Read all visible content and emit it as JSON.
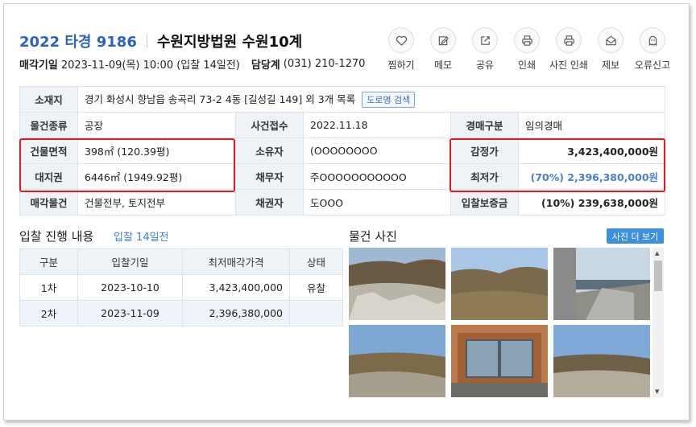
{
  "header": {
    "case_number": "2022 타경 9186",
    "court": "수원지방법원 수원10계",
    "sale_date_label": "매각기일",
    "sale_date_value": "2023-11-09(목) 10:00 (입찰 14일전)",
    "dept_label": "담당계",
    "dept_phone": "(031) 210-1270"
  },
  "actions": [
    {
      "label": "찜하기",
      "icon": "heart-icon"
    },
    {
      "label": "메모",
      "icon": "memo-icon"
    },
    {
      "label": "공유",
      "icon": "share-icon"
    },
    {
      "label": "인쇄",
      "icon": "print-icon"
    },
    {
      "label": "사진 인쇄",
      "icon": "photo-print-icon"
    },
    {
      "label": "제보",
      "icon": "report-icon"
    },
    {
      "label": "오류신고",
      "icon": "error-report-icon"
    }
  ],
  "info": {
    "location_label": "소재지",
    "location_value": "경기 화성시 향남읍 송곡리 73-2 4동 [길성길 149] 외 3개 목록",
    "road_search_button": "도로명 검색",
    "type_label": "물건종류",
    "type_value": "공장",
    "case_received_label": "사건접수",
    "case_received_value": "2022.11.18",
    "auction_type_label": "경매구분",
    "auction_type_value": "임의경매",
    "building_area_label": "건물면적",
    "building_area_value": "398㎡ (120.39평)",
    "owner_label": "소유자",
    "owner_value": "(OOOOOOOO",
    "appraisal_label": "감정가",
    "appraisal_value": "3,423,400,000원",
    "land_right_label": "대지권",
    "land_right_value": "6446㎡ (1949.92평)",
    "debtor_label": "채무자",
    "debtor_value": "주OOOOOOOOOOO",
    "min_price_label": "최저가",
    "min_price_value": "(70%) 2,396,380,000원",
    "sale_items_label": "매각물건",
    "sale_items_value": "건물전부, 토지전부",
    "creditor_label": "채권자",
    "creditor_value": "도OOO",
    "deposit_label": "입찰보증금",
    "deposit_value": "(10%) 239,638,000원"
  },
  "bidding": {
    "title": "입찰 진행 내용",
    "badge": "입찰 14일전",
    "columns": [
      "구분",
      "입찰기일",
      "최저매각가격",
      "상태"
    ],
    "rows": [
      [
        "1차",
        "2023-10-10",
        "3,423,400,000",
        "유찰"
      ],
      [
        "2차",
        "2023-11-09",
        "2,396,380,000",
        ""
      ]
    ]
  },
  "photos": {
    "title": "물건 사진",
    "more_button": "사진 더 보기"
  }
}
